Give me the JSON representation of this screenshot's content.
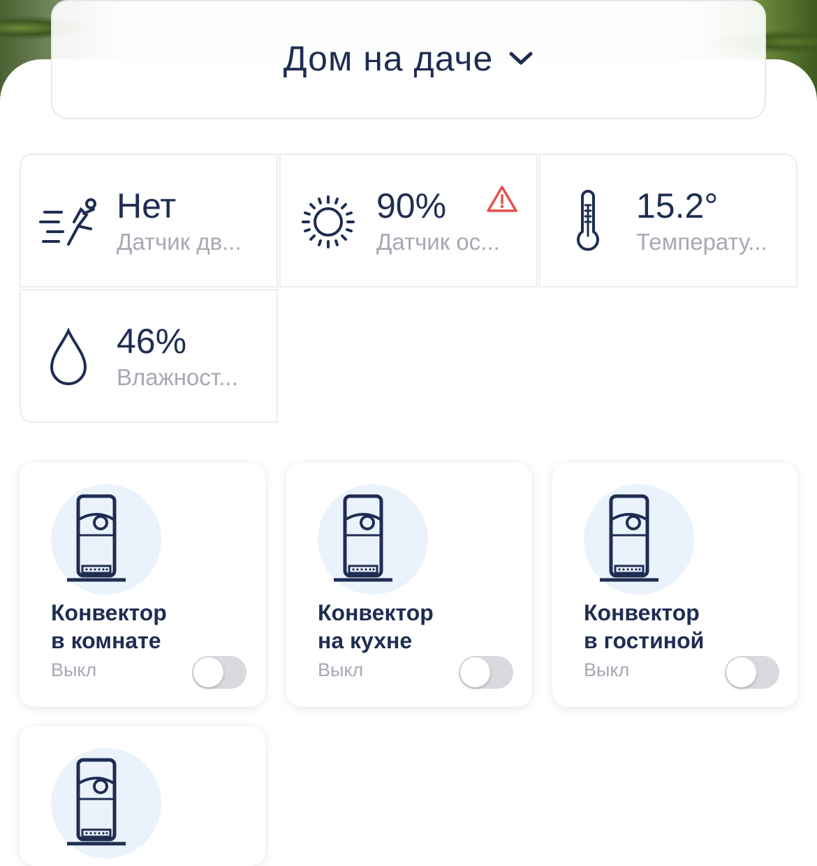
{
  "header": {
    "home_name": "Дом на даче",
    "dropdown_icon": "chevron-down-icon"
  },
  "sensors": [
    {
      "icon": "motion-icon",
      "value": "Нет",
      "label": "Датчик дв..."
    },
    {
      "icon": "sun-icon",
      "value": "90%",
      "label": "Датчик ос...",
      "warning_icon": "warning-icon",
      "warning_color": "#e2524a"
    },
    {
      "icon": "thermometer-icon",
      "value": "15.2°",
      "label": "Температу..."
    },
    {
      "icon": "droplet-icon",
      "value": "46%",
      "label": "Влажност..."
    }
  ],
  "devices": [
    {
      "icon": "convector-icon",
      "name_line1": "Конвектор",
      "name_line2": "в комнате",
      "state": "Выкл",
      "on": false
    },
    {
      "icon": "convector-icon",
      "name_line1": "Конвектор",
      "name_line2": "на кухне",
      "state": "Выкл",
      "on": false
    },
    {
      "icon": "convector-icon",
      "name_line1": "Конвектор",
      "name_line2": "в гостиной",
      "state": "Выкл",
      "on": false
    },
    {
      "icon": "convector-icon"
    }
  ],
  "colors": {
    "primary_text": "#1f2d52",
    "secondary_text": "#a6a9b4",
    "icon_bg": "#eaf2fc",
    "toggle_off": "#d9d9df",
    "warning": "#e2524a"
  }
}
